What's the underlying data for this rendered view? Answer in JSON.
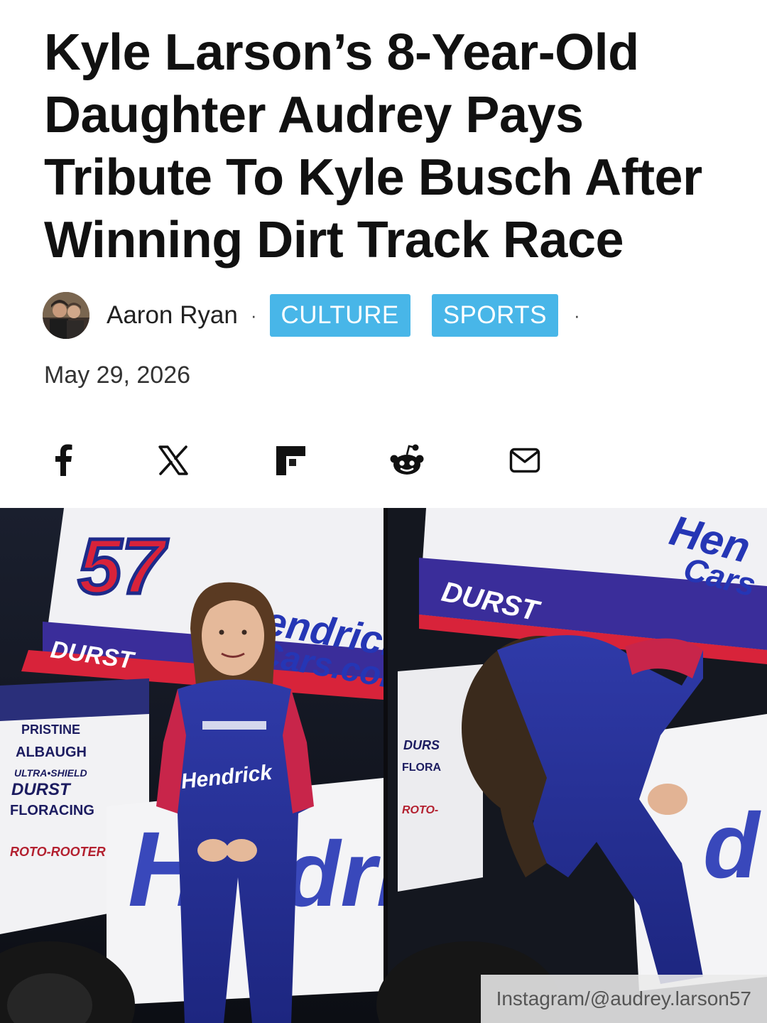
{
  "article": {
    "title": "Kyle Larson’s 8-Year-Old Daughter Audrey Pays Tribute To Kyle Busch After Winning Dirt Track Race",
    "author": "Aaron Ryan",
    "separator": "·",
    "tags": [
      "CULTURE",
      "SPORTS"
    ],
    "date": "May 29, 2026",
    "tag_color": "#48b6e8"
  },
  "share": {
    "buttons": [
      {
        "icon": "facebook-icon"
      },
      {
        "icon": "x-icon"
      },
      {
        "icon": "flipboard-icon"
      },
      {
        "icon": "reddit-icon"
      },
      {
        "icon": "email-icon"
      }
    ]
  },
  "image": {
    "credit": "Instagram/@audrey.larson57",
    "car_number": "57",
    "car_texts": [
      "Hendrick",
      "Cars.com",
      "DURST",
      "PRISTINE",
      "ALBAUGH",
      "ULTRA•SHIELD",
      "FLORACING",
      "ROTO-ROOTER"
    ]
  }
}
